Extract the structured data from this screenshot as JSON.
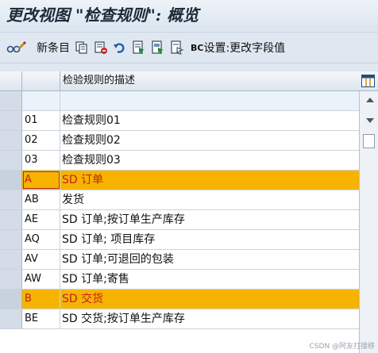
{
  "window": {
    "title": "更改视图 \"检查规则\": 概览"
  },
  "toolbar": {
    "new_entries_label": "新条目",
    "bc_prefix": "BC",
    "bc_label": "设置:更改字段值"
  },
  "table": {
    "column_header": "检验规则的描述",
    "rows": [
      {
        "key": "",
        "desc": ""
      },
      {
        "key": "01",
        "desc": "检查规则01"
      },
      {
        "key": "02",
        "desc": "检查规则02"
      },
      {
        "key": "03",
        "desc": "检查规则03"
      },
      {
        "key": "A",
        "desc": "SD 订单"
      },
      {
        "key": "AB",
        "desc": "发货"
      },
      {
        "key": "AE",
        "desc": "SD 订单;按订单生产库存"
      },
      {
        "key": "AQ",
        "desc": "SD 订单; 项目库存"
      },
      {
        "key": "AV",
        "desc": "SD 订单;可退回的包装"
      },
      {
        "key": "AW",
        "desc": "SD 订单;寄售"
      },
      {
        "key": "B",
        "desc": "SD 交货"
      },
      {
        "key": "BE",
        "desc": "SD 交货;按订单生产库存"
      }
    ]
  },
  "colors": {
    "highlight": "#f6b400",
    "highlight_text": "#c0211f"
  },
  "watermark": "CSDN @阿友打接移"
}
